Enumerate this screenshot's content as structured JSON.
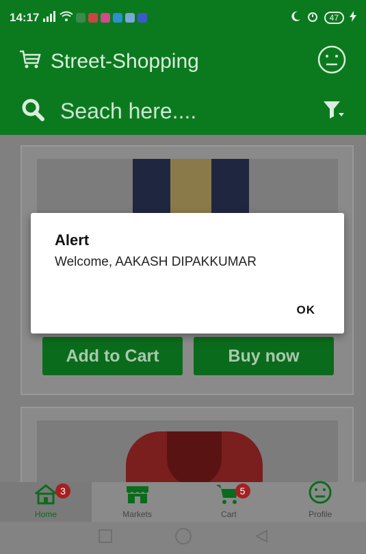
{
  "status_bar": {
    "time": "14:17",
    "battery": "47"
  },
  "app_bar": {
    "title": "Street-Shopping"
  },
  "search": {
    "placeholder": "Seach here...."
  },
  "products": [
    {
      "add_to_cart_label": "Add to Cart",
      "buy_now_label": "Buy now"
    }
  ],
  "dialog": {
    "title": "Alert",
    "message": "Welcome, AAKASH DIPAKKUMAR",
    "ok_label": "OK"
  },
  "bottom_nav": {
    "items": [
      {
        "label": "Home",
        "icon": "home-icon",
        "badge": "3"
      },
      {
        "label": "Markets",
        "icon": "store-icon"
      },
      {
        "label": "Cart",
        "icon": "cart-icon",
        "badge": "5"
      },
      {
        "label": "Profile",
        "icon": "smiley-icon"
      }
    ]
  },
  "colors": {
    "primary": "#0b7a1f",
    "badge": "#a52020",
    "scrim": "#808080"
  }
}
